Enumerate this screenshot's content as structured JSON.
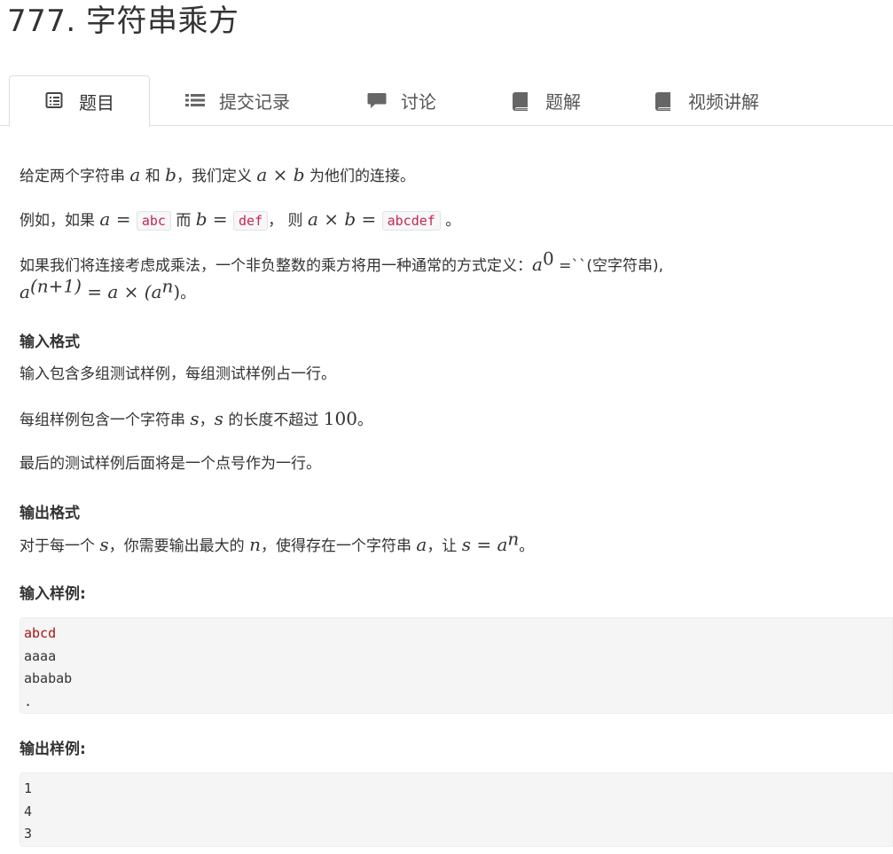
{
  "problem": {
    "title": "777. 字符串乘方"
  },
  "tabs": [
    {
      "label": "题目",
      "icon": "list-alt-icon"
    },
    {
      "label": "提交记录",
      "icon": "list-icon"
    },
    {
      "label": "讨论",
      "icon": "comment-icon"
    },
    {
      "label": "题解",
      "icon": "book-icon"
    },
    {
      "label": "视频讲解",
      "icon": "book-icon"
    }
  ],
  "desc": {
    "p1": {
      "t1": "给定两个字符串 ",
      "a": "a",
      "t2": " 和 ",
      "b": "b",
      "t3": "，我们定义 ",
      "expr": "a × b",
      "t4": " 为他们的连接。"
    },
    "p2": {
      "t1": "例如，如果 ",
      "a": "a",
      "eq": " = ",
      "code1": "abc",
      "t2": " 而 ",
      "b": "b",
      "eq2": " = ",
      "code2": "def",
      "t3": "，  则 ",
      "expr": "a × b",
      "eq3": " = ",
      "code3": "abcdef",
      "t4": " 。"
    },
    "p3": {
      "t1": "如果我们将连接考虑成乘法，一个非负整数的乘方将用一种通常的方式定义：",
      "a0": "a",
      "sup0": "0",
      "t2": " =``(空字符串),"
    },
    "p3b": {
      "a": "a",
      "sup": "(n+1)",
      "rest": " = a × (a",
      "sup2": "n",
      "close": ")",
      "end": "。"
    },
    "input_h": "输入格式",
    "input_p1": "输入包含多组测试样例，每组测试样例占一行。",
    "input_p2": {
      "t1": "每组样例包含一个字符串 ",
      "s": "s",
      "t2": "，",
      "s2": "s",
      "t3": " 的长度不超过 ",
      "num": "100",
      "t4": "。"
    },
    "input_p3": "最后的测试样例后面将是一个点号作为一行。",
    "output_h": "输出格式",
    "output_p": {
      "t1": "对于每一个 ",
      "s": "s",
      "t2": "，你需要输出最大的 ",
      "n": "n",
      "t3": "，使得存在一个字符串 ",
      "a": "a",
      "t4": "，让 ",
      "expr": "s = a",
      "sup": "n",
      "t5": "。"
    },
    "sample_in_h": "输入样例:",
    "sample_in": [
      "abcd",
      "aaaa",
      "ababab",
      "."
    ],
    "sample_out_h": "输出样例:",
    "sample_out": [
      "1",
      "4",
      "3"
    ]
  }
}
